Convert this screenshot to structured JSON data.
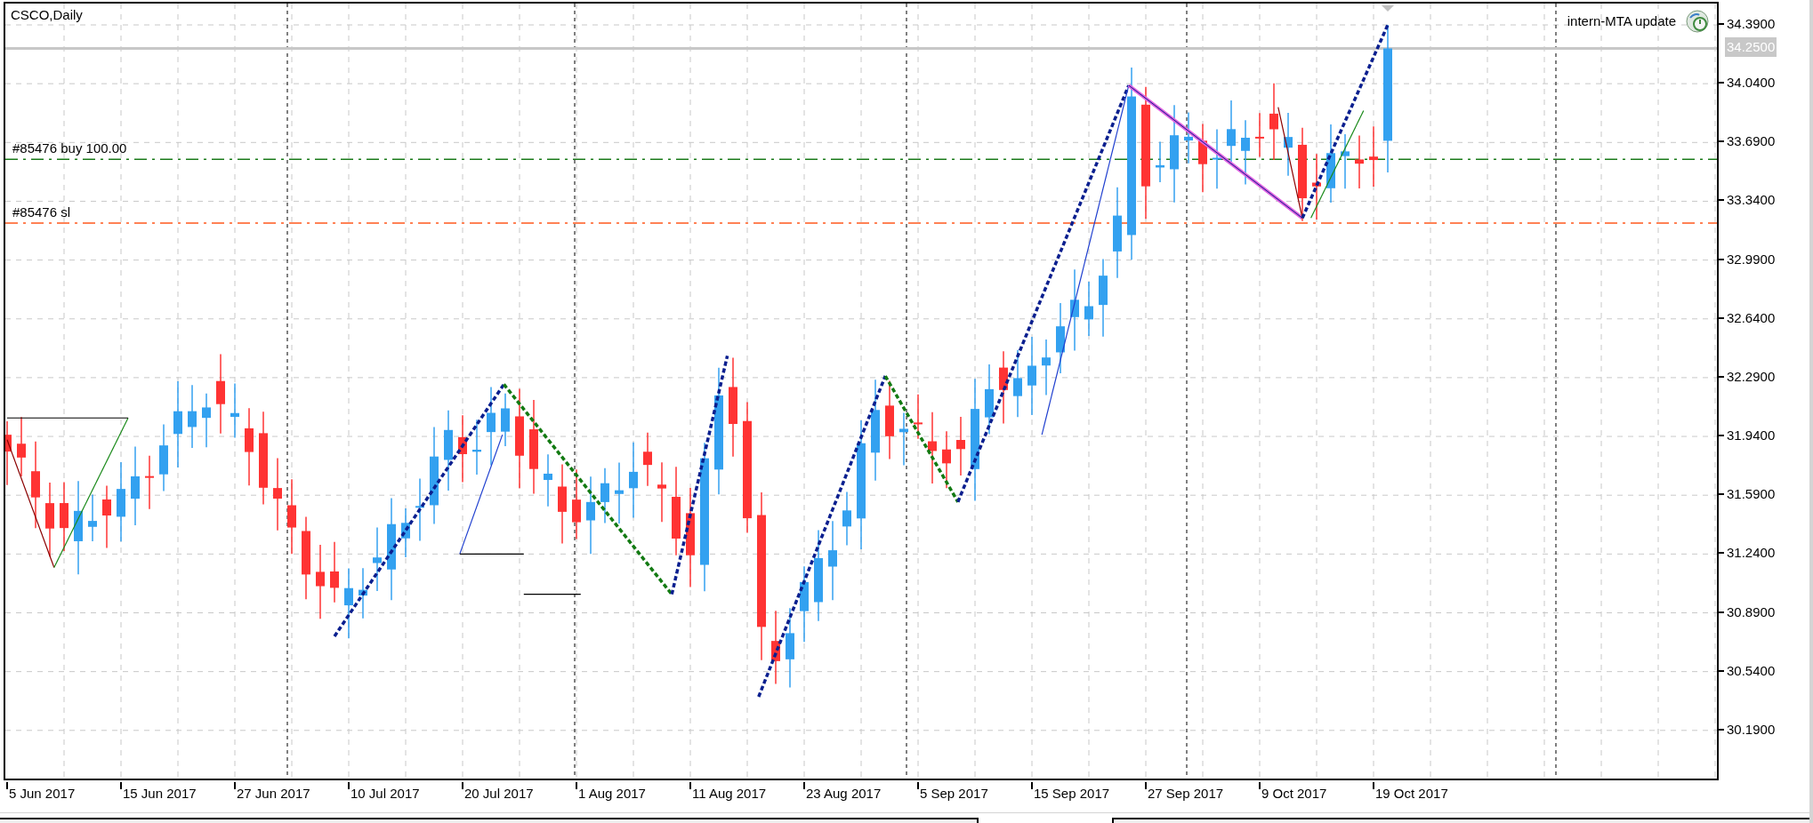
{
  "chart": {
    "title": "CSCO,Daily",
    "indicator_label": "intern-MTA update",
    "current_price": "34.2500",
    "order_lines": [
      {
        "label": "#85476 buy 100.00",
        "kind": "buy"
      },
      {
        "label": "#85476 sl",
        "kind": "sl"
      }
    ],
    "price_ticks": [
      "34.3900",
      "34.0400",
      "33.6900",
      "33.3400",
      "32.9900",
      "32.6400",
      "32.2900",
      "31.9400",
      "31.5900",
      "31.2400",
      "30.8900",
      "30.5400",
      "30.1900"
    ],
    "date_labels": [
      "5 Jun 2017",
      "15 Jun 2017",
      "27 Jun 2017",
      "10 Jul 2017",
      "20 Jul 2017",
      "1 Aug 2017",
      "11 Aug 2017",
      "23 Aug 2017",
      "5 Sep 2017",
      "15 Sep 2017",
      "27 Sep 2017",
      "9 Oct 2017",
      "19 Oct 2017"
    ]
  }
}
